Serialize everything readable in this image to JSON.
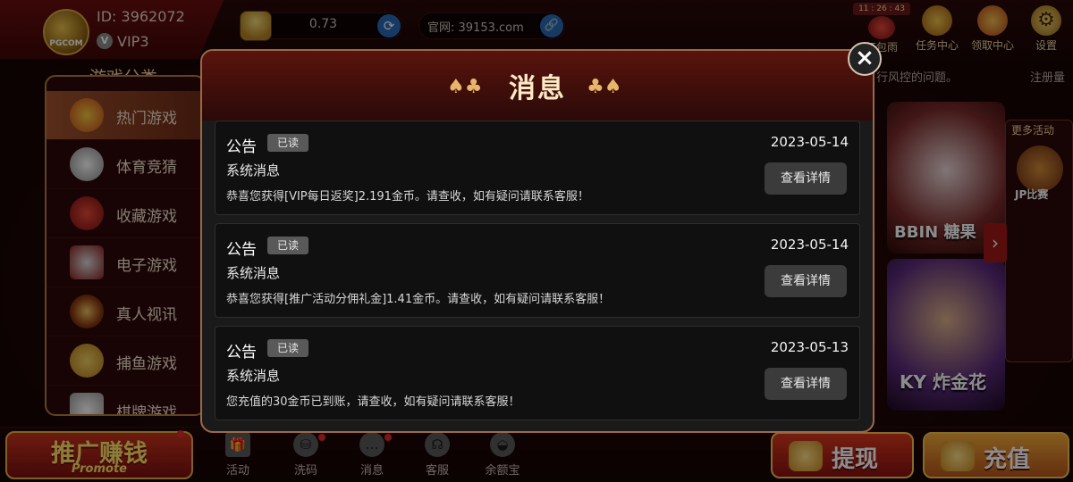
{
  "user": {
    "id": "ID: 3962072",
    "vip": "VIP3",
    "avatar_text": "PGCOM"
  },
  "wallet": {
    "balance": "0.73"
  },
  "site": {
    "url": "官网: 39153.com"
  },
  "top_icons": {
    "timer": "11 : 26 : 43",
    "items": [
      "红包雨",
      "任务中心",
      "领取中心",
      "设置"
    ]
  },
  "sidebar": {
    "title": "游戏分类",
    "items": [
      "热门游戏",
      "体育竞猜",
      "收藏游戏",
      "电子游戏",
      "真人视讯",
      "捕鱼游戏",
      "棋牌游戏"
    ]
  },
  "background": {
    "notice": "行风控的问题。",
    "register": "注册量",
    "more_activity": "更多活动",
    "more_activity_item": "JP比赛",
    "games": [
      "BBIN 糖果",
      "KY 炸金花"
    ]
  },
  "bottom_nav": {
    "promote_title": "推广赚钱",
    "promote_sub": "Promote",
    "items": [
      "活动",
      "洗码",
      "消息",
      "客服",
      "余额宝"
    ],
    "withdraw": "提现",
    "deposit": "充值"
  },
  "modal": {
    "title": "消息",
    "close": "×",
    "messages": [
      {
        "type": "公告",
        "status": "已读",
        "date": "2023-05-14",
        "subject": "系统消息",
        "body": "恭喜您获得[VIP每日返奖]2.191金币。请查收，如有疑问请联系客服！",
        "action": "查看详情"
      },
      {
        "type": "公告",
        "status": "已读",
        "date": "2023-05-14",
        "subject": "系统消息",
        "body": "恭喜您获得[推广活动分佣礼金]1.41金币。请查收，如有疑问请联系客服！",
        "action": "查看详情"
      },
      {
        "type": "公告",
        "status": "已读",
        "date": "2023-05-13",
        "subject": "系统消息",
        "body": "您充值的30金币已到账，请查收，如有疑问请联系客服！",
        "action": "查看详情"
      }
    ]
  },
  "colors": {
    "accent_gold": "#f2c24f",
    "modal_bg": "#1b1a1a",
    "read_badge": "#595959",
    "link_blue": "#2a6ab8"
  }
}
